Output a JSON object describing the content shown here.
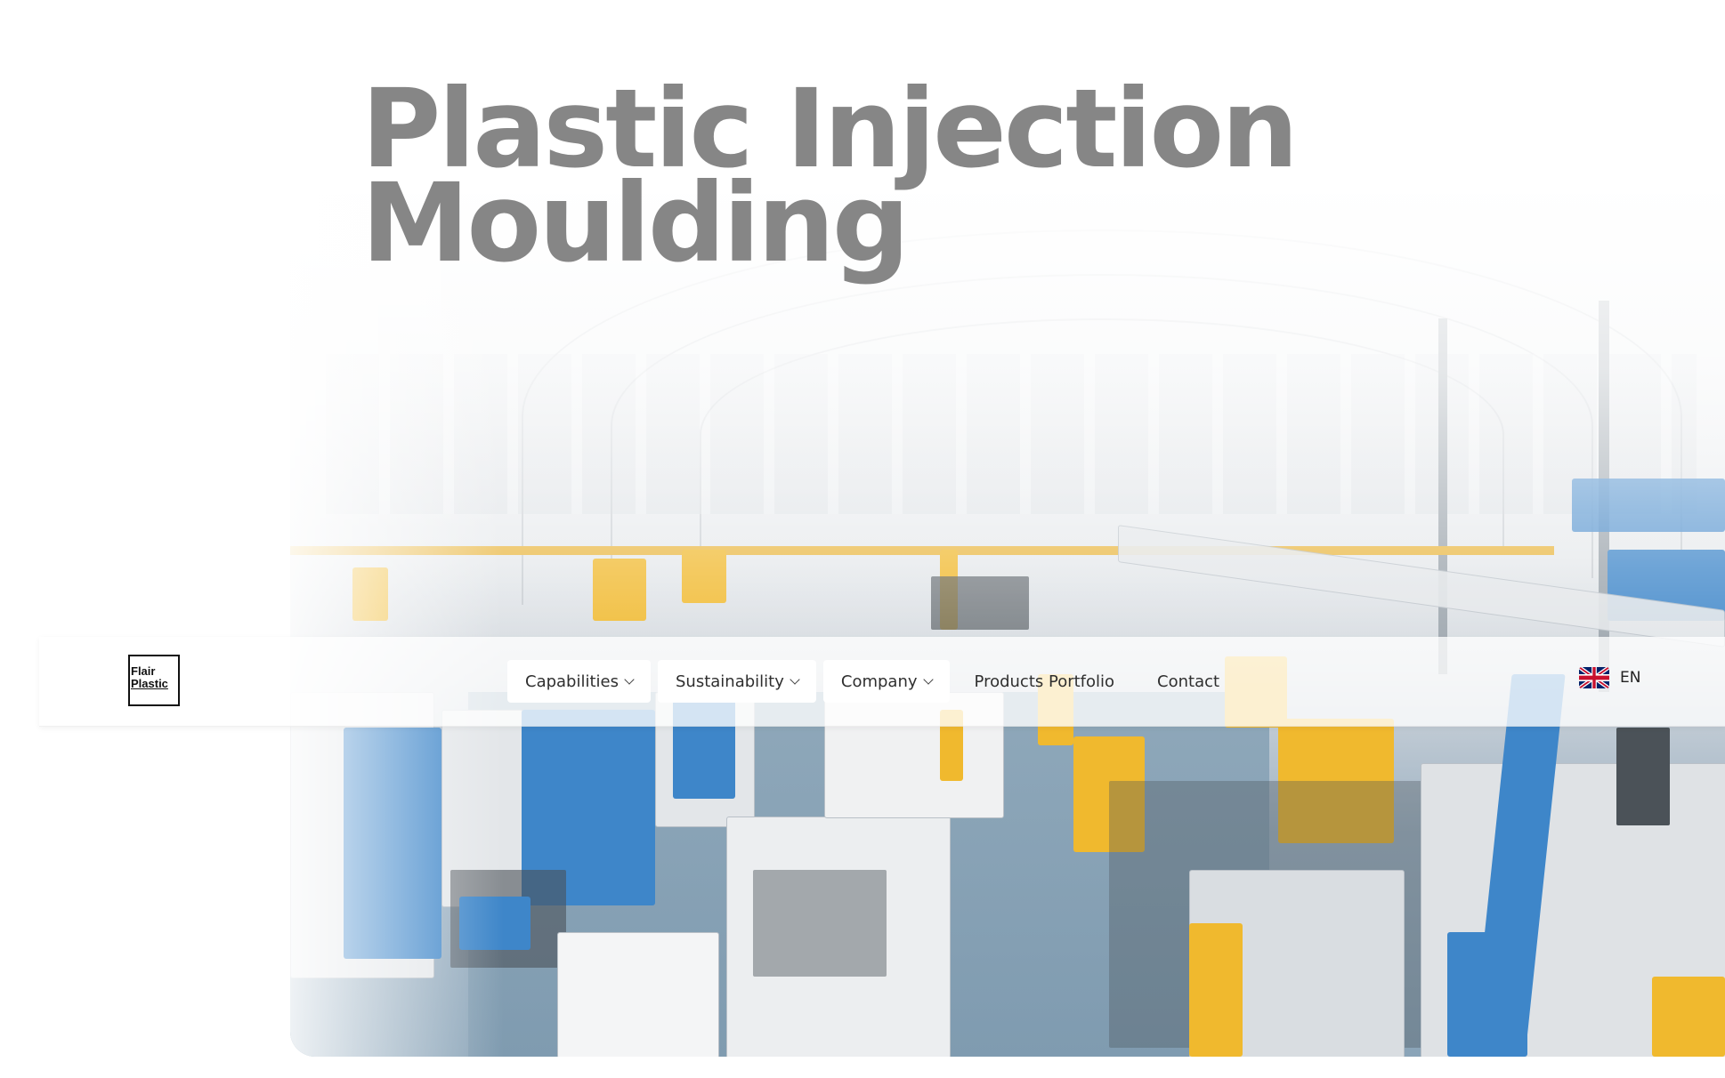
{
  "hero": {
    "title_line1": "Plastic Injection",
    "title_line2": "Moulding",
    "image_description_icon": "factory-floor-image"
  },
  "header": {
    "logo": {
      "line1": "Flair",
      "line2": "Plastic"
    },
    "nav": [
      {
        "label": "Capabilities",
        "has_dropdown": true
      },
      {
        "label": "Sustainability",
        "has_dropdown": true
      },
      {
        "label": "Company",
        "has_dropdown": true
      },
      {
        "label": "Products Portfolio",
        "has_dropdown": false
      },
      {
        "label": "Contact",
        "has_dropdown": false
      }
    ],
    "language": {
      "code": "EN",
      "flag_icon": "uk-flag-icon"
    }
  },
  "colors": {
    "heading": "#868686",
    "nav_text": "#2f2f2f",
    "machine_blue": "#3e86c9",
    "machine_yellow": "#f0b92e"
  }
}
